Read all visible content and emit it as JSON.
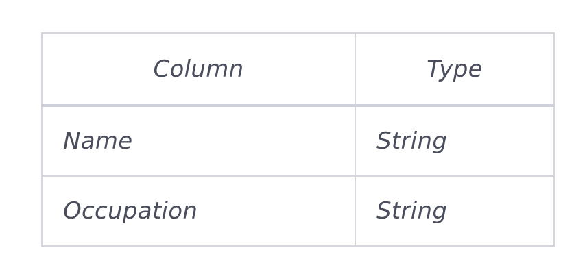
{
  "table": {
    "headers": [
      "Column",
      "Type"
    ],
    "rows": [
      [
        "Name",
        "String"
      ],
      [
        "Occupation",
        "String"
      ]
    ]
  }
}
